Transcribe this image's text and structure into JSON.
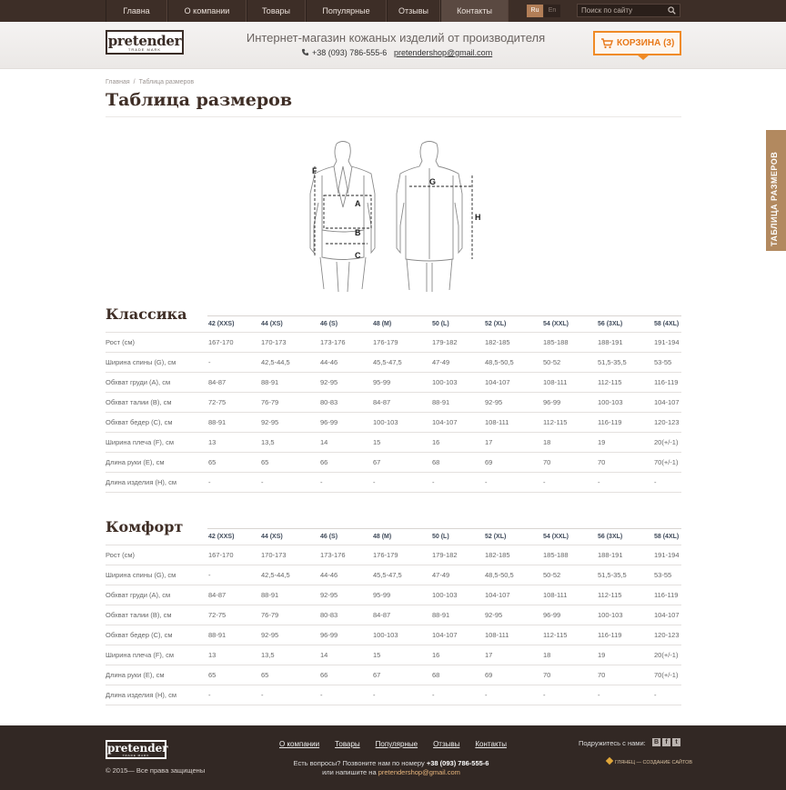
{
  "nav": {
    "items": [
      "Главна",
      "О компании",
      "Товары",
      "Популярные",
      "Отзывы",
      "Контакты"
    ],
    "active": "Контакты",
    "lang_ru": "Ru",
    "lang_en": "En",
    "search_placeholder": "Поиск по сайту"
  },
  "header": {
    "logo": "pretender",
    "logo_sub": "TRADE MARK",
    "tagline": "Интернет-магазин кожаных изделий от производителя",
    "phone": "+38 (093) 786-555-6",
    "email": "pretendershop@gmail.com",
    "cart": "КОРЗИНА (3)"
  },
  "side_tab": "ТАБЛИЦА РАЗМЕРОВ",
  "breadcrumb": {
    "home": "Главная",
    "sep": "/",
    "current": "Таблица размеров"
  },
  "page_title": "Таблица размеров",
  "figure_labels": [
    "F",
    "A",
    "E",
    "B",
    "C",
    "G",
    "H"
  ],
  "sizes": [
    "42 (XXS)",
    "44 (XS)",
    "46 (S)",
    "48 (M)",
    "50 (L)",
    "52 (XL)",
    "54 (XXL)",
    "56 (3XL)",
    "58 (4XL)"
  ],
  "tables": [
    {
      "title": "Классика",
      "rows": [
        {
          "label": "Рост (см)",
          "values": [
            "167-170",
            "170-173",
            "173-176",
            "176-179",
            "179-182",
            "182-185",
            "185-188",
            "188-191",
            "191-194"
          ]
        },
        {
          "label": "Ширина спины (G), см",
          "values": [
            "-",
            "42,5-44,5",
            "44-46",
            "45,5-47,5",
            "47-49",
            "48,5-50,5",
            "50-52",
            "51,5-35,5",
            "53-55"
          ]
        },
        {
          "label": "Обхват груди (A), см",
          "values": [
            "84-87",
            "88-91",
            "92-95",
            "95-99",
            "100-103",
            "104-107",
            "108-111",
            "112-115",
            "116-119"
          ]
        },
        {
          "label": "Обхват талии (B), см",
          "values": [
            "72-75",
            "76-79",
            "80-83",
            "84-87",
            "88-91",
            "92-95",
            "96-99",
            "100-103",
            "104-107"
          ]
        },
        {
          "label": "Обхват бедер (C), см",
          "values": [
            "88-91",
            "92-95",
            "96-99",
            "100-103",
            "104-107",
            "108-111",
            "112-115",
            "116-119",
            "120-123"
          ]
        },
        {
          "label": "Ширина плеча (F), см",
          "values": [
            "13",
            "13,5",
            "14",
            "15",
            "16",
            "17",
            "18",
            "19",
            "20(+/-1)"
          ]
        },
        {
          "label": "Длина руки (E), см",
          "values": [
            "65",
            "65",
            "66",
            "67",
            "68",
            "69",
            "70",
            "70",
            "70(+/-1)"
          ]
        },
        {
          "label": "Длина изделия (H), см",
          "values": [
            "-",
            "-",
            "-",
            "-",
            "-",
            "-",
            "-",
            "-",
            "-"
          ]
        }
      ]
    },
    {
      "title": "Комфорт",
      "rows": [
        {
          "label": "Рост (см)",
          "values": [
            "167-170",
            "170-173",
            "173-176",
            "176-179",
            "179-182",
            "182-185",
            "185-188",
            "188-191",
            "191-194"
          ]
        },
        {
          "label": "Ширина спины (G), см",
          "values": [
            "-",
            "42,5-44,5",
            "44-46",
            "45,5-47,5",
            "47-49",
            "48,5-50,5",
            "50-52",
            "51,5-35,5",
            "53-55"
          ]
        },
        {
          "label": "Обхват груди (A), см",
          "values": [
            "84-87",
            "88-91",
            "92-95",
            "95-99",
            "100-103",
            "104-107",
            "108-111",
            "112-115",
            "116-119"
          ]
        },
        {
          "label": "Обхват талии (B), см",
          "values": [
            "72-75",
            "76-79",
            "80-83",
            "84-87",
            "88-91",
            "92-95",
            "96-99",
            "100-103",
            "104-107"
          ]
        },
        {
          "label": "Обхват бедер (C), см",
          "values": [
            "88-91",
            "92-95",
            "96-99",
            "100-103",
            "104-107",
            "108-111",
            "112-115",
            "116-119",
            "120-123"
          ]
        },
        {
          "label": "Ширина плеча (F), см",
          "values": [
            "13",
            "13,5",
            "14",
            "15",
            "16",
            "17",
            "18",
            "19",
            "20(+/-1)"
          ]
        },
        {
          "label": "Длина руки (E), см",
          "values": [
            "65",
            "65",
            "66",
            "67",
            "68",
            "69",
            "70",
            "70",
            "70(+/-1)"
          ]
        },
        {
          "label": "Длина изделия (H), см",
          "values": [
            "-",
            "-",
            "-",
            "-",
            "-",
            "-",
            "-",
            "-",
            "-"
          ]
        }
      ]
    }
  ],
  "footer": {
    "logo": "pretender",
    "logo_sub": "TRADE MARK",
    "copyright": "© 2015— Все права защищены",
    "links": [
      "О компании",
      "Товары",
      "Популярные",
      "Отзывы",
      "Контакты"
    ],
    "contact_prefix": "Есть вопросы? Позвоните нам по номеру",
    "contact_phone": "+38 (093) 786-555-6",
    "contact_mid": "или напишите на",
    "contact_email": "pretendershop@gmail.com",
    "social_label": "Подружитесь с нами:",
    "social_icons": [
      "В",
      "f",
      "t"
    ],
    "credit": "ГЛЯНЕЦ — СОЗДАНИЕ САЙТОВ"
  },
  "colors": {
    "topbar": "#3d2e27",
    "accent_orange": "#f08a24",
    "side_tab": "#b2895f",
    "title_brown": "#3f2e26",
    "footer": "#322824"
  }
}
